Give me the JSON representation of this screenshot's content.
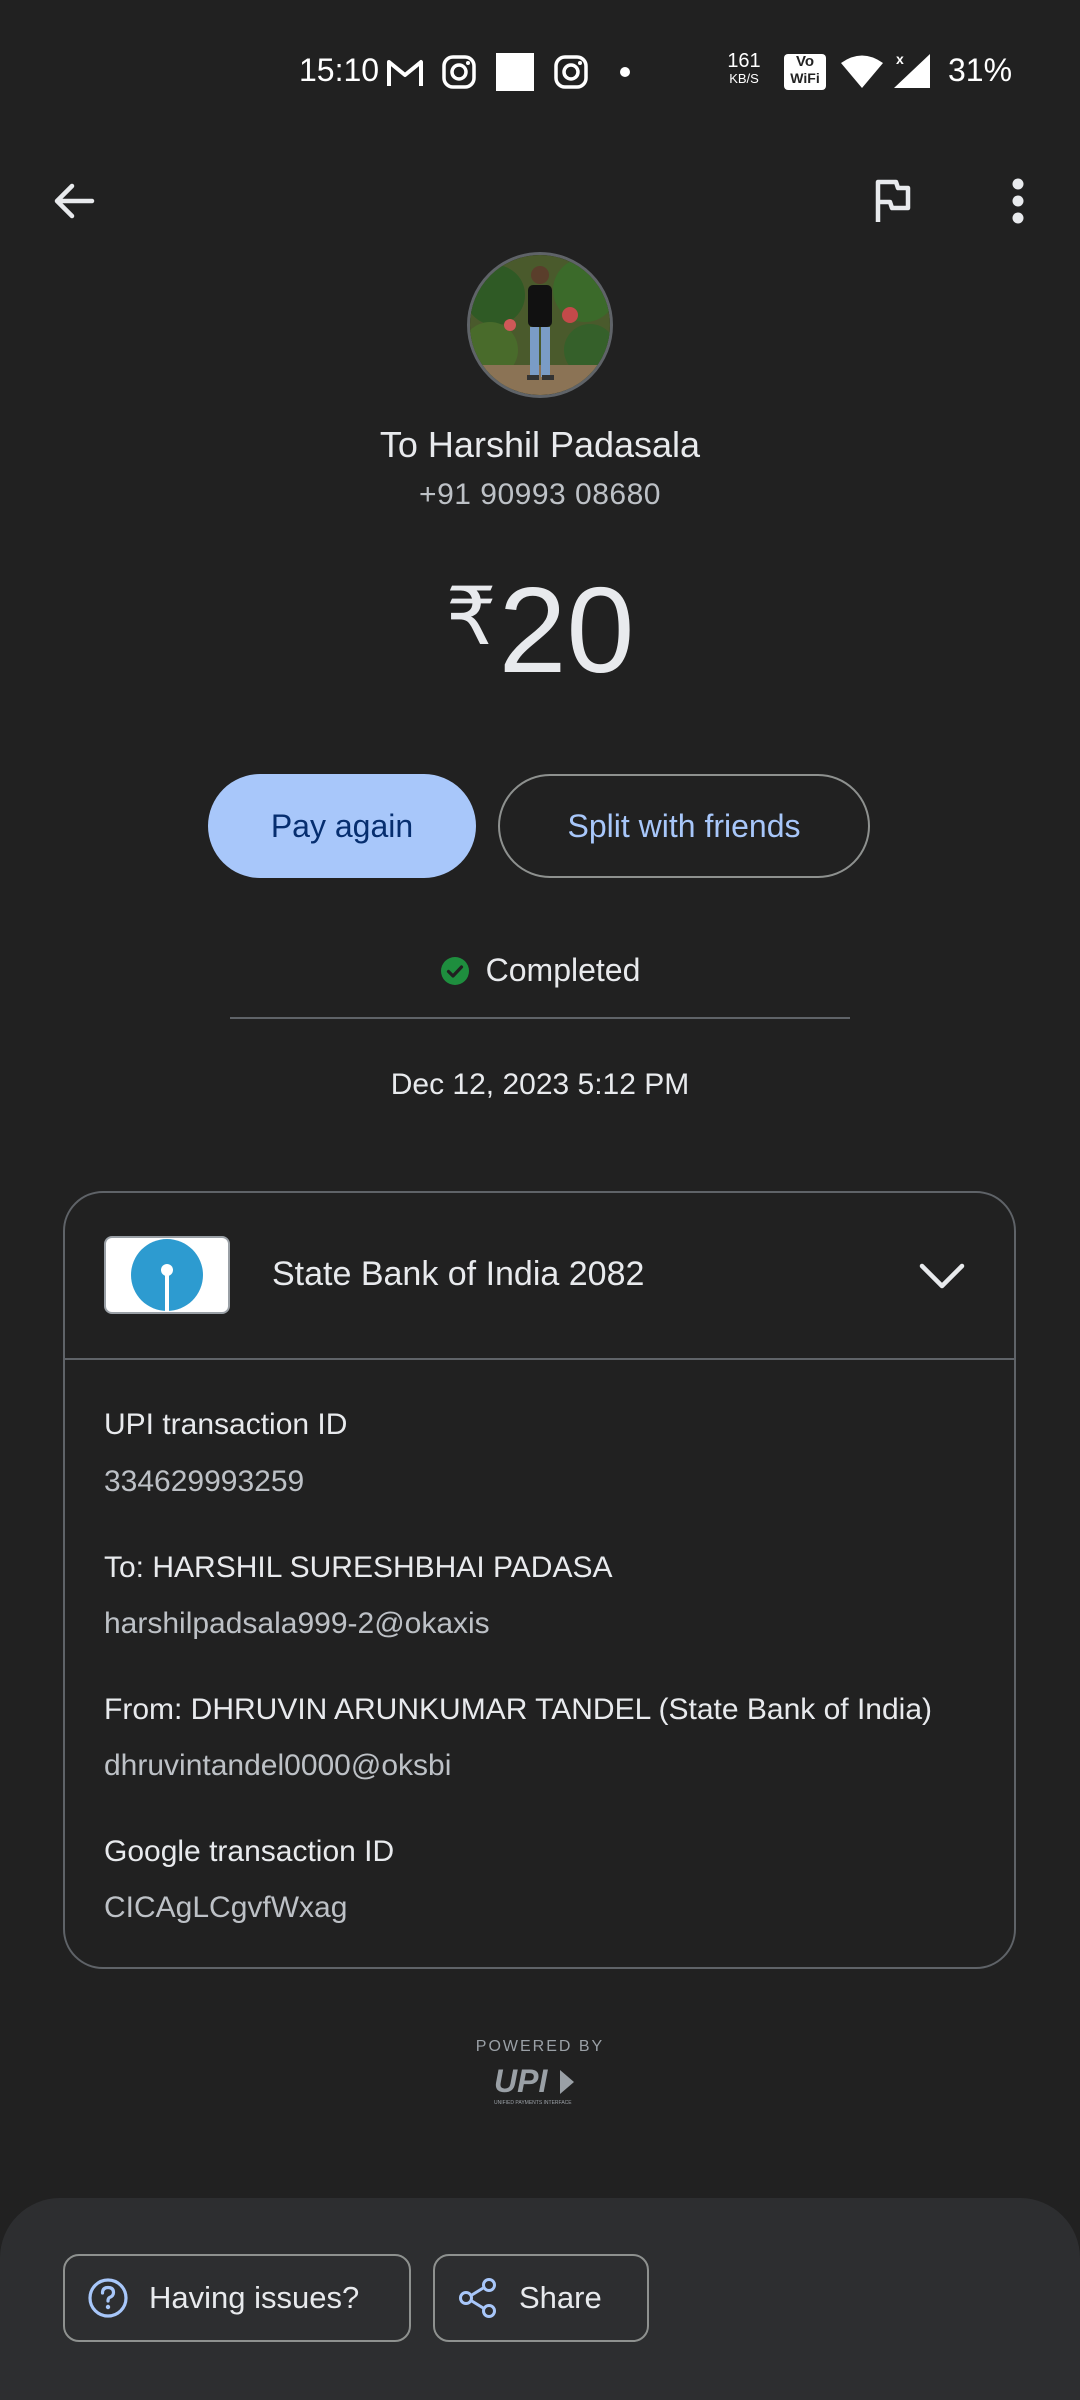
{
  "status_bar": {
    "time": "15:10",
    "net_speed_top": "161",
    "net_speed_bottom": "KB/S",
    "vowifi_top": "Vo",
    "vowifi_bottom": "WiFi",
    "battery": "31%",
    "icons": [
      "gmail-icon",
      "instagram-icon",
      "white-square-icon",
      "instagram-icon",
      "dot-icon",
      "wifi-icon",
      "signal-icon"
    ]
  },
  "top_bar": {
    "icons": [
      "back-arrow-icon",
      "flag-icon",
      "more-vert-icon"
    ]
  },
  "payee": {
    "name": "To Harshil Padasala",
    "phone": "+91 90993 08680"
  },
  "amount": {
    "currency": "₹",
    "value": "20"
  },
  "actions": {
    "pay_again": "Pay again",
    "split": "Split with friends"
  },
  "transaction": {
    "status": "Completed",
    "datetime": "Dec 12, 2023 5:12 PM"
  },
  "bank": {
    "name": "State Bank of India 2082"
  },
  "details": [
    {
      "label": "UPI transaction ID",
      "value": "334629993259"
    },
    {
      "label": "To: HARSHIL SURESHBHAI PADASA",
      "value": "harshilpadsala999-2@okaxis"
    },
    {
      "label": "From: DHRUVIN ARUNKUMAR TANDEL (State Bank of India)",
      "value": "dhruvintandel0000@oksbi"
    },
    {
      "label": "Google transaction ID",
      "value": "CICAgLCgvfWxag"
    }
  ],
  "footer": {
    "powered_by": "POWERED BY",
    "upi_logo": "UPI",
    "upi_tagline": "UNIFIED PAYMENTS INTERFACE"
  },
  "bottom_actions": {
    "issues": "Having issues?",
    "share": "Share"
  },
  "colors": {
    "background": "#212121",
    "accent": "#a8c7fa",
    "success": "#1e8e3e"
  }
}
